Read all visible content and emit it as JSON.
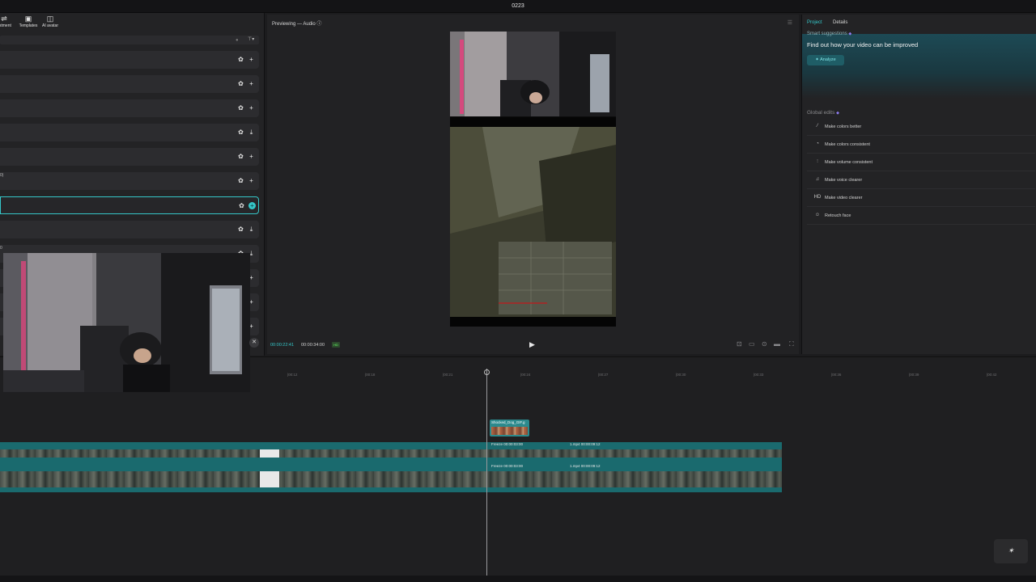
{
  "window": {
    "title": "0223"
  },
  "toolbar": {
    "items": [
      {
        "label": "ustment",
        "icon": "sliders-icon"
      },
      {
        "label": "Templates",
        "icon": "template-icon"
      },
      {
        "label": "AI avatar",
        "icon": "ai-avatar-icon"
      }
    ]
  },
  "assets": {
    "rows": [
      {
        "name": "",
        "action": "+"
      },
      {
        "name": "",
        "action": "+"
      },
      {
        "name": "",
        "action": "+"
      },
      {
        "name": "",
        "action": "⤓"
      },
      {
        "name": "",
        "action": "+"
      },
      {
        "name": "0)",
        "action": "+"
      },
      {
        "name": "",
        "action": "+",
        "selected": true
      },
      {
        "name": "",
        "action": "⤓"
      },
      {
        "name": "0",
        "action": "⤓"
      },
      {
        "name": "",
        "action": "+"
      },
      {
        "name": "",
        "action": "+"
      },
      {
        "name": "",
        "action": "+"
      }
    ]
  },
  "preview": {
    "title": "Previewing — Audio ⓘ",
    "current_time": "00:00:22:41",
    "total_time": "00:00:34:00",
    "quality_badge": "HD"
  },
  "right_panel": {
    "tabs": [
      "Project",
      "Details"
    ],
    "smart_suggestions_label": "Smart suggestions",
    "suggest_heading": "Find out how your video can be improved",
    "analyze_label": "Analyze",
    "global_edits_label": "Global edits",
    "global_edits": [
      {
        "label": "Make colors better",
        "icon": "magic-wand-icon"
      },
      {
        "label": "Make colors consistent",
        "icon": "palette-icon"
      },
      {
        "label": "Make volume consistent",
        "icon": "volume-sliders-icon"
      },
      {
        "label": "Make voice clearer",
        "icon": "voice-icon"
      },
      {
        "label": "Make video clearer",
        "icon": "hd-icon"
      },
      {
        "label": "Retouch face",
        "icon": "face-icon"
      }
    ]
  },
  "timeline": {
    "ruler": [
      "|00:12",
      "|00:18",
      "|00:21",
      "|00:24",
      "|00:27",
      "|00:30",
      "|00:33",
      "|00:36",
      "|00:39",
      "|00:42"
    ],
    "gif_clip_label": "Shocked_Dog_GIF.g",
    "track1_freeze": "Freeze  00:00:03:00",
    "track1_mp4": "1.mp4  00:00:09:12",
    "track2_freeze": "Freeze  00:00:03:00",
    "track2_mp4": "1.mp4  00:00:09:12"
  },
  "colors": {
    "accent": "#35c7c9",
    "clip": "#1a6a6e"
  }
}
